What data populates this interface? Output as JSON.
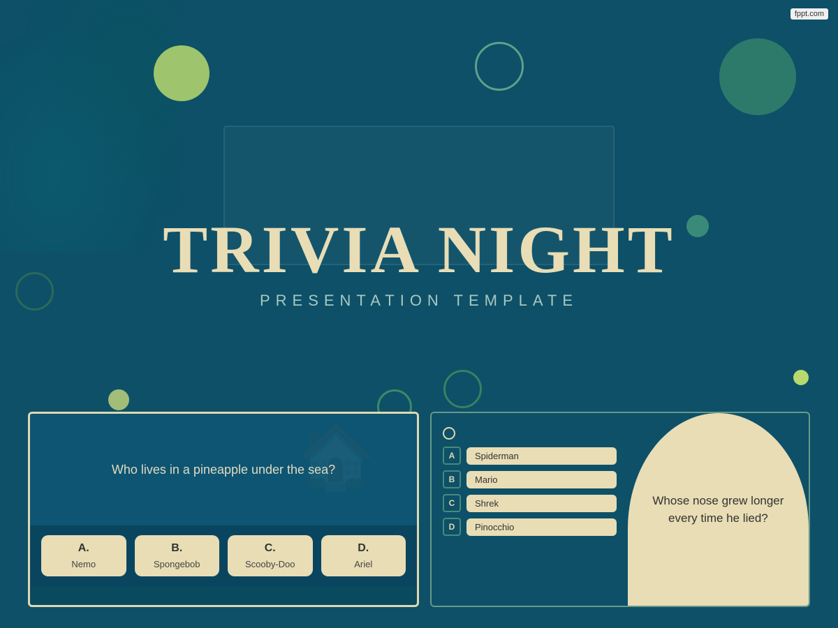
{
  "watermark": {
    "text": "fppt.com"
  },
  "main": {
    "title": "TRIVIA NIGHT",
    "subtitle": "PRESENTATION TEMPLATE"
  },
  "slide1": {
    "question": "Who lives in a pineapple under the sea?",
    "answers": [
      {
        "letter": "A.",
        "text": "Nemo"
      },
      {
        "letter": "B.",
        "text": "Spongebob"
      },
      {
        "letter": "C.",
        "text": "Scooby-Doo"
      },
      {
        "letter": "D.",
        "text": "Ariel"
      }
    ]
  },
  "slide2": {
    "question": "Whose nose grew longer every time he lied?",
    "answers": [
      {
        "badge": "A",
        "text": "Spiderman"
      },
      {
        "badge": "B",
        "text": "Mario"
      },
      {
        "badge": "C",
        "text": "Shrek"
      },
      {
        "badge": "D",
        "text": "Pinocchio"
      }
    ]
  }
}
